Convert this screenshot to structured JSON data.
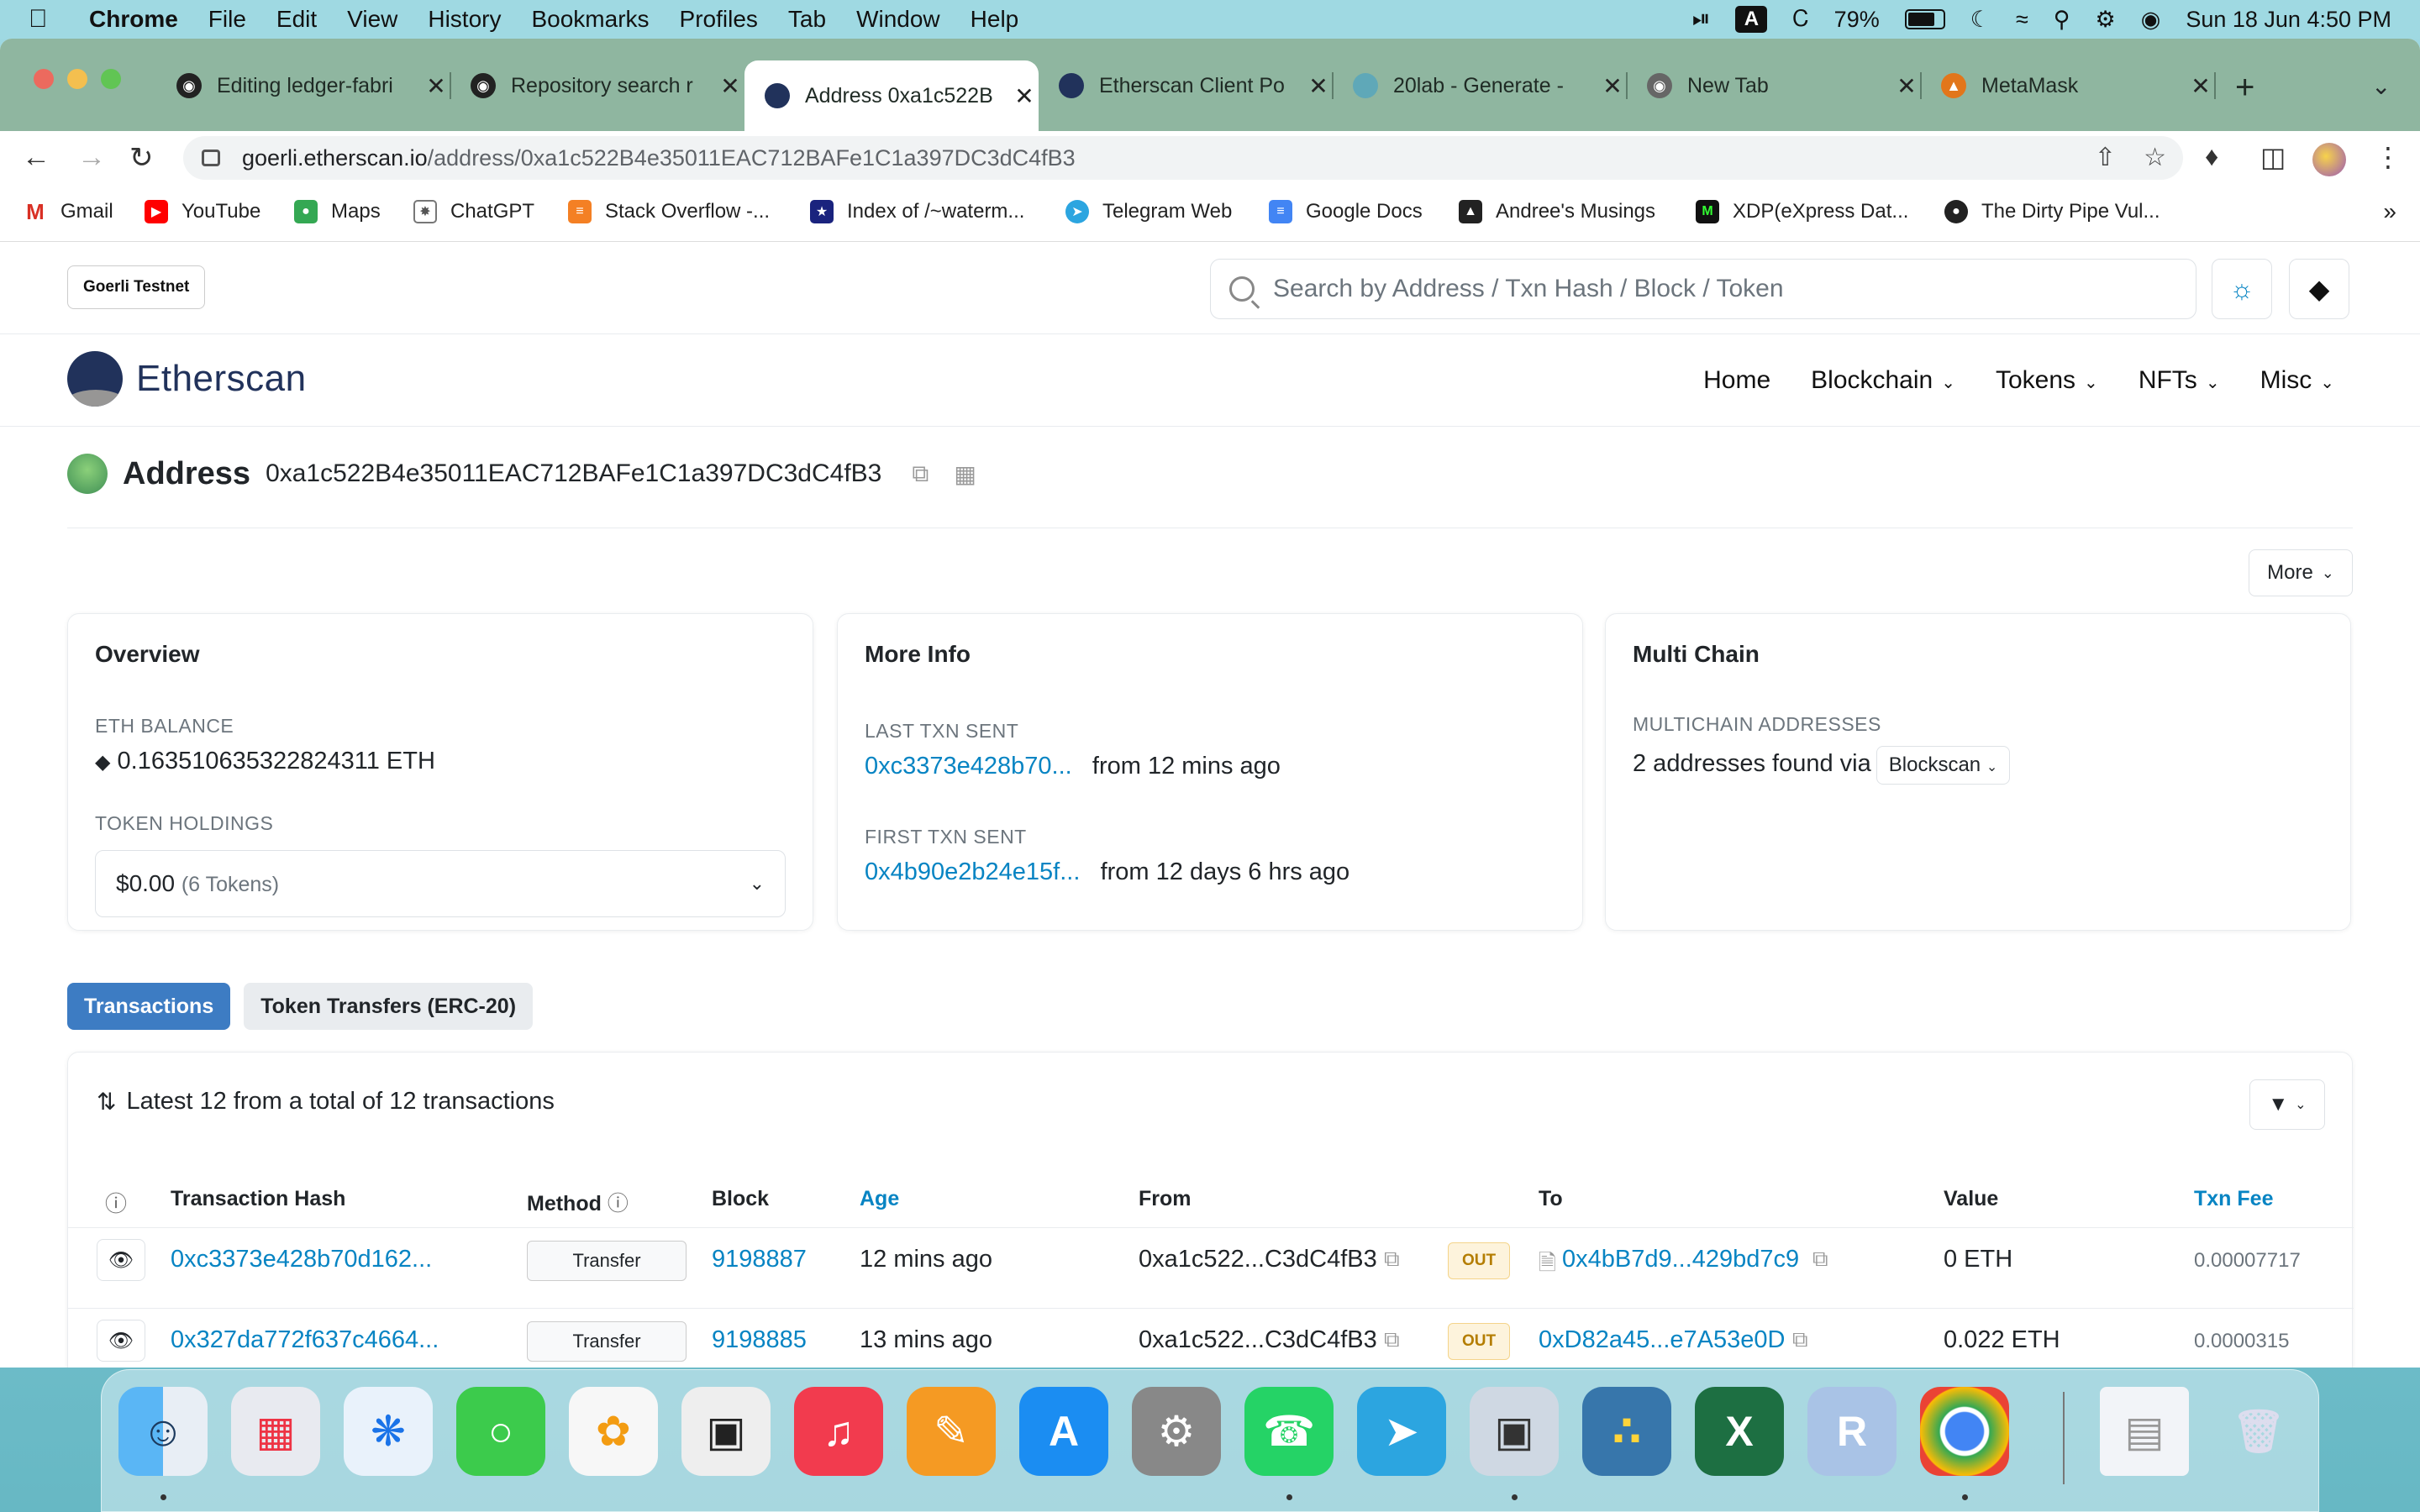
{
  "menubar": {
    "app": "Chrome",
    "items": [
      "File",
      "Edit",
      "View",
      "History",
      "Bookmarks",
      "Profiles",
      "Tab",
      "Window",
      "Help"
    ],
    "battery": "79%",
    "datetime": "Sun 18 Jun  4:50 PM"
  },
  "tabs": [
    {
      "title": "Editing ledger-fabri",
      "icon": "github-icon"
    },
    {
      "title": "Repository search r",
      "icon": "github-icon"
    },
    {
      "title": "Address 0xa1c522B",
      "icon": "etherscan-icon"
    },
    {
      "title": "Etherscan Client Po",
      "icon": "etherscan-icon"
    },
    {
      "title": "20lab - Generate -",
      "icon": "20lab-icon"
    },
    {
      "title": "New Tab",
      "icon": "chrome-icon"
    },
    {
      "title": "MetaMask",
      "icon": "metamask-icon"
    }
  ],
  "url": {
    "host": "goerli.etherscan.io",
    "path": "/address/0xa1c522B4e35011EAC712BAFe1C1a397DC3dC4fB3"
  },
  "bookmarks": [
    "Gmail",
    "YouTube",
    "Maps",
    "ChatGPT",
    "Stack Overflow -...",
    "Index of /~waterm...",
    "Telegram Web",
    "Google Docs",
    "Andree's Musings",
    "XDP(eXpress Dat...",
    "The Dirty Pipe Vul..."
  ],
  "site": {
    "network": "Goerli Testnet",
    "search_placeholder": "Search by Address / Txn Hash / Block / Token",
    "logo": "Etherscan",
    "nav": [
      "Home",
      "Blockchain",
      "Tokens",
      "NFTs",
      "Misc"
    ],
    "address_label": "Address",
    "address": "0xa1c522B4e35011EAC712BAFe1C1a397DC3dC4fB3",
    "more": "More",
    "overview": {
      "title": "Overview",
      "eth_balance_label": "ETH BALANCE",
      "eth_balance": "0.163510635322824311 ETH",
      "token_label": "TOKEN HOLDINGS",
      "token_value": "$0.00",
      "token_count": "(6 Tokens)"
    },
    "moreinfo": {
      "title": "More Info",
      "last_label": "LAST TXN SENT",
      "last_hash": "0xc3373e428b70...",
      "last_time": "from 12 mins ago",
      "first_label": "FIRST TXN SENT",
      "first_hash": "0x4b90e2b24e15f...",
      "first_time": "from 12 days 6 hrs ago"
    },
    "multichain": {
      "title": "Multi Chain",
      "label": "MULTICHAIN ADDRESSES",
      "text": "2 addresses found via",
      "source": "Blockscan"
    },
    "tab_transactions": "Transactions",
    "tab_tokens": "Token Transfers (ERC-20)",
    "tx_summary": "Latest 12 from a total of 12 transactions",
    "columns": [
      "Transaction Hash",
      "Method",
      "Block",
      "Age",
      "From",
      "To",
      "Value",
      "Txn Fee"
    ],
    "rows": [
      {
        "hash": "0xc3373e428b70d162...",
        "method": "Transfer",
        "block": "9198887",
        "age": "12 mins ago",
        "from": "0xa1c522...C3dC4fB3",
        "dir": "OUT",
        "to": "0x4bB7d9...429bd7c9",
        "value": "0 ETH",
        "fee": "0.00007717"
      },
      {
        "hash": "0x327da772f637c4664...",
        "method": "Transfer",
        "block": "9198885",
        "age": "13 mins ago",
        "from": "0xa1c522...C3dC4fB3",
        "dir": "OUT",
        "to": "0xD82a45...e7A53e0D",
        "value": "0.022 ETH",
        "fee": "0.0000315"
      }
    ]
  }
}
